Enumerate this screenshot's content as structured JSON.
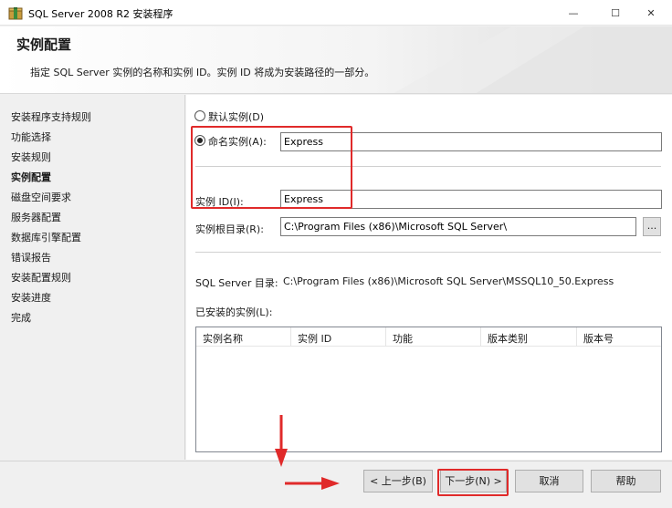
{
  "window": {
    "title": "SQL Server 2008 R2 安装程序",
    "minimize": "—",
    "maximize": "☐",
    "close": "✕",
    "icon": "sql-installer-icon"
  },
  "header": {
    "title": "实例配置",
    "description": "指定 SQL Server 实例的名称和实例 ID。实例 ID 将成为安装路径的一部分。"
  },
  "nav": {
    "items": [
      {
        "label": "安装程序支持规则"
      },
      {
        "label": "功能选择"
      },
      {
        "label": "安装规则"
      },
      {
        "label": "实例配置"
      },
      {
        "label": "磁盘空间要求"
      },
      {
        "label": "服务器配置"
      },
      {
        "label": "数据库引擎配置"
      },
      {
        "label": "错误报告"
      },
      {
        "label": "安装配置规则"
      },
      {
        "label": "安装进度"
      },
      {
        "label": "完成"
      }
    ],
    "active_index": 3
  },
  "form": {
    "default_instance_label": "默认实例(D)",
    "named_instance_label": "命名实例(A):",
    "named_instance_value": "Express",
    "instance_id_label": "实例 ID(I):",
    "instance_id_value": "Express",
    "root_dir_label": "实例根目录(R):",
    "root_dir_value": "C:\\Program Files (x86)\\Microsoft SQL Server\\",
    "browse_label": "...",
    "sql_dir_label": "SQL Server 目录:",
    "sql_dir_value": "C:\\Program Files (x86)\\Microsoft SQL Server\\MSSQL10_50.Express",
    "installed_label": "已安装的实例(L):"
  },
  "grid": {
    "columns": [
      "实例名称",
      "实例 ID",
      "功能",
      "版本类别",
      "版本号"
    ]
  },
  "buttons": {
    "back": "< 上一步(B)",
    "next": "下一步(N) >",
    "cancel": "取消",
    "help": "帮助"
  },
  "colors": {
    "highlight": "#e02a2a",
    "arrow": "#e02a2a"
  }
}
